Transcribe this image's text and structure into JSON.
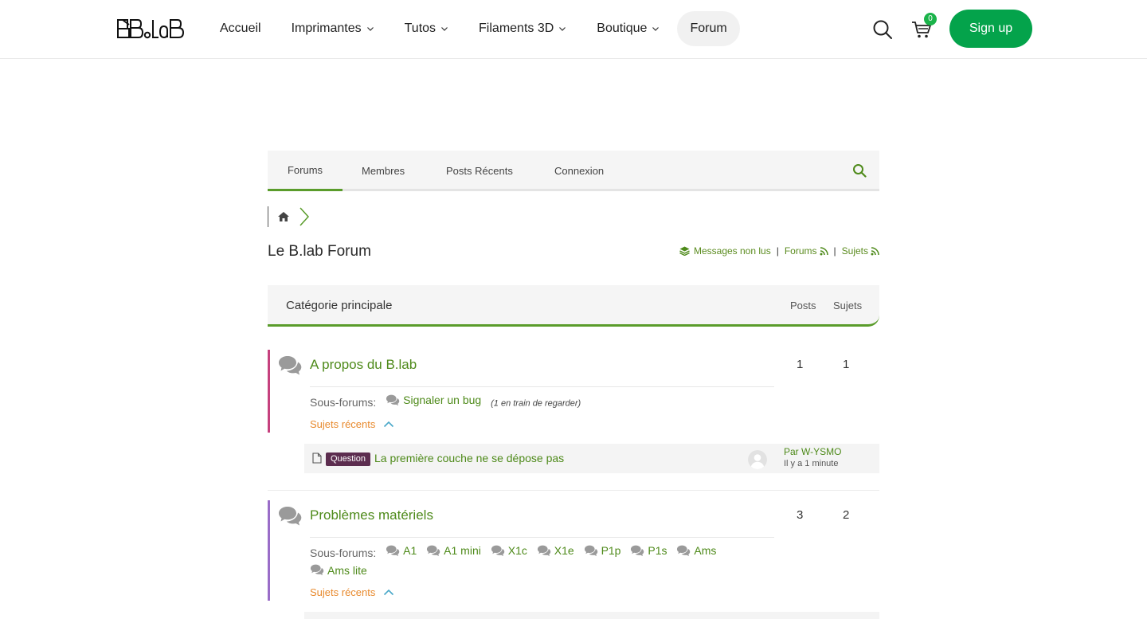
{
  "header": {
    "nav": [
      {
        "label": "Accueil",
        "dropdown": false,
        "active": false
      },
      {
        "label": "Imprimantes",
        "dropdown": true,
        "active": false
      },
      {
        "label": "Tutos",
        "dropdown": true,
        "active": false
      },
      {
        "label": "Filaments 3D",
        "dropdown": true,
        "active": false
      },
      {
        "label": "Boutique",
        "dropdown": true,
        "active": false
      },
      {
        "label": "Forum",
        "dropdown": false,
        "active": true
      }
    ],
    "cart_count": "0",
    "signup_label": "Sign up"
  },
  "forum_menu": {
    "items": [
      "Forums",
      "Membres",
      "Posts Récents",
      "Connexion"
    ],
    "active": "Forums"
  },
  "page": {
    "title": "Le B.lab Forum",
    "links": {
      "unread": "Messages non lus",
      "forums": "Forums",
      "topics": "Sujets"
    }
  },
  "category": {
    "title": "Catégorie principale",
    "col_posts": "Posts",
    "col_topics": "Sujets"
  },
  "forums": [
    {
      "title": "A propos du B.lab",
      "posts": "1",
      "topics": "1",
      "stripe_color": "#c6417e",
      "subforums_label": "Sous-forums:",
      "subforums": [
        "Signaler un bug"
      ],
      "subforum_note": "(1 en train de regarder)",
      "recent_label": "Sujets récents",
      "recent_topic": {
        "badge": "Question",
        "title": "La première couche ne se dépose pas",
        "by": "Par W-YSMO",
        "ago": "Il y a 1 minute"
      }
    },
    {
      "title": "Problèmes matériels",
      "posts": "3",
      "topics": "2",
      "stripe_color": "#9a6dc8",
      "subforums_label": "Sous-forums:",
      "subforums": [
        "A1",
        "A1 mini",
        "X1c",
        "X1e",
        "P1p",
        "P1s",
        "Ams",
        "Ams lite"
      ],
      "recent_label": "Sujets récents"
    }
  ],
  "colors": {
    "accent_green": "#5a9c2b",
    "link_green": "#4e8a1a",
    "signup_green": "#04a34b",
    "recent_orange": "#e88a2e",
    "badge_purple": "#5c2d4f"
  }
}
